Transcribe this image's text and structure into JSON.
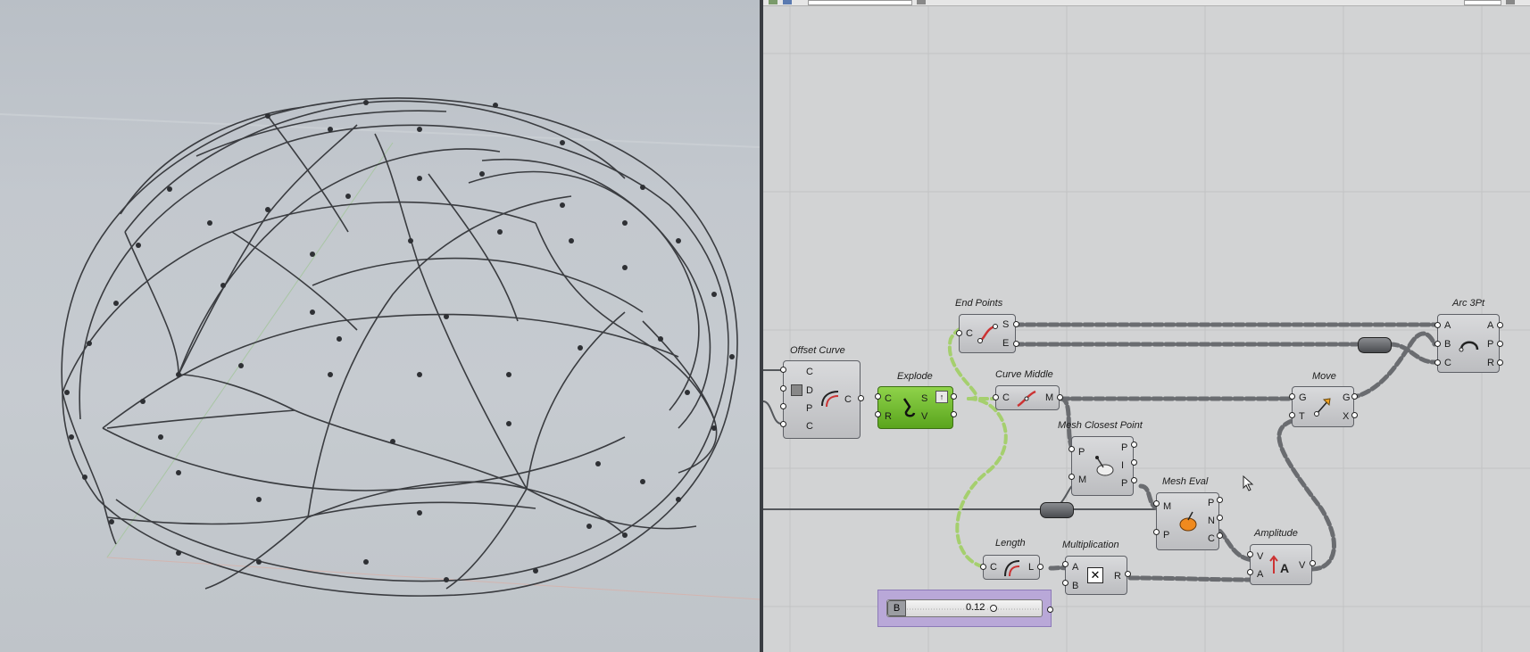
{
  "canvas": {
    "components": {
      "offset_curve": {
        "title": "Offset Curve",
        "in": [
          "C",
          "D",
          "P",
          "C"
        ],
        "out": [
          "C"
        ]
      },
      "explode": {
        "title": "Explode",
        "in": [
          "C",
          "R"
        ],
        "out": [
          "S",
          "V"
        ]
      },
      "end_points": {
        "title": "End Points",
        "in": [
          "C"
        ],
        "out": [
          "S",
          "E"
        ]
      },
      "curve_middle": {
        "title": "Curve Middle",
        "in": [
          "C"
        ],
        "out": [
          "M"
        ]
      },
      "mesh_closest_point": {
        "title": "Mesh Closest Point",
        "in": [
          "P",
          "M"
        ],
        "out": [
          "P",
          "I",
          "P"
        ]
      },
      "mesh_eval": {
        "title": "Mesh Eval",
        "in": [
          "M",
          "P"
        ],
        "out": [
          "P",
          "N",
          "C"
        ]
      },
      "length": {
        "title": "Length",
        "in": [
          "C"
        ],
        "out": [
          "L"
        ]
      },
      "multiplication": {
        "title": "Multiplication",
        "in": [
          "A",
          "B"
        ],
        "out": [
          "R"
        ]
      },
      "amplitude": {
        "title": "Amplitude",
        "in": [
          "V",
          "A"
        ],
        "out": [
          "V"
        ]
      },
      "move": {
        "title": "Move",
        "in": [
          "G",
          "T"
        ],
        "out": [
          "G",
          "X"
        ]
      },
      "arc_3pt": {
        "title": "Arc 3Pt",
        "in": [
          "A",
          "B",
          "C"
        ],
        "out": [
          "A",
          "P",
          "R"
        ]
      }
    },
    "slider": {
      "label": "B",
      "value": "0.12"
    }
  },
  "colors": {
    "component": "#c4c5c8",
    "explode_selected": "#6cb82a",
    "slider_group": "#b9a8d8",
    "wire": "#5b5d60"
  }
}
